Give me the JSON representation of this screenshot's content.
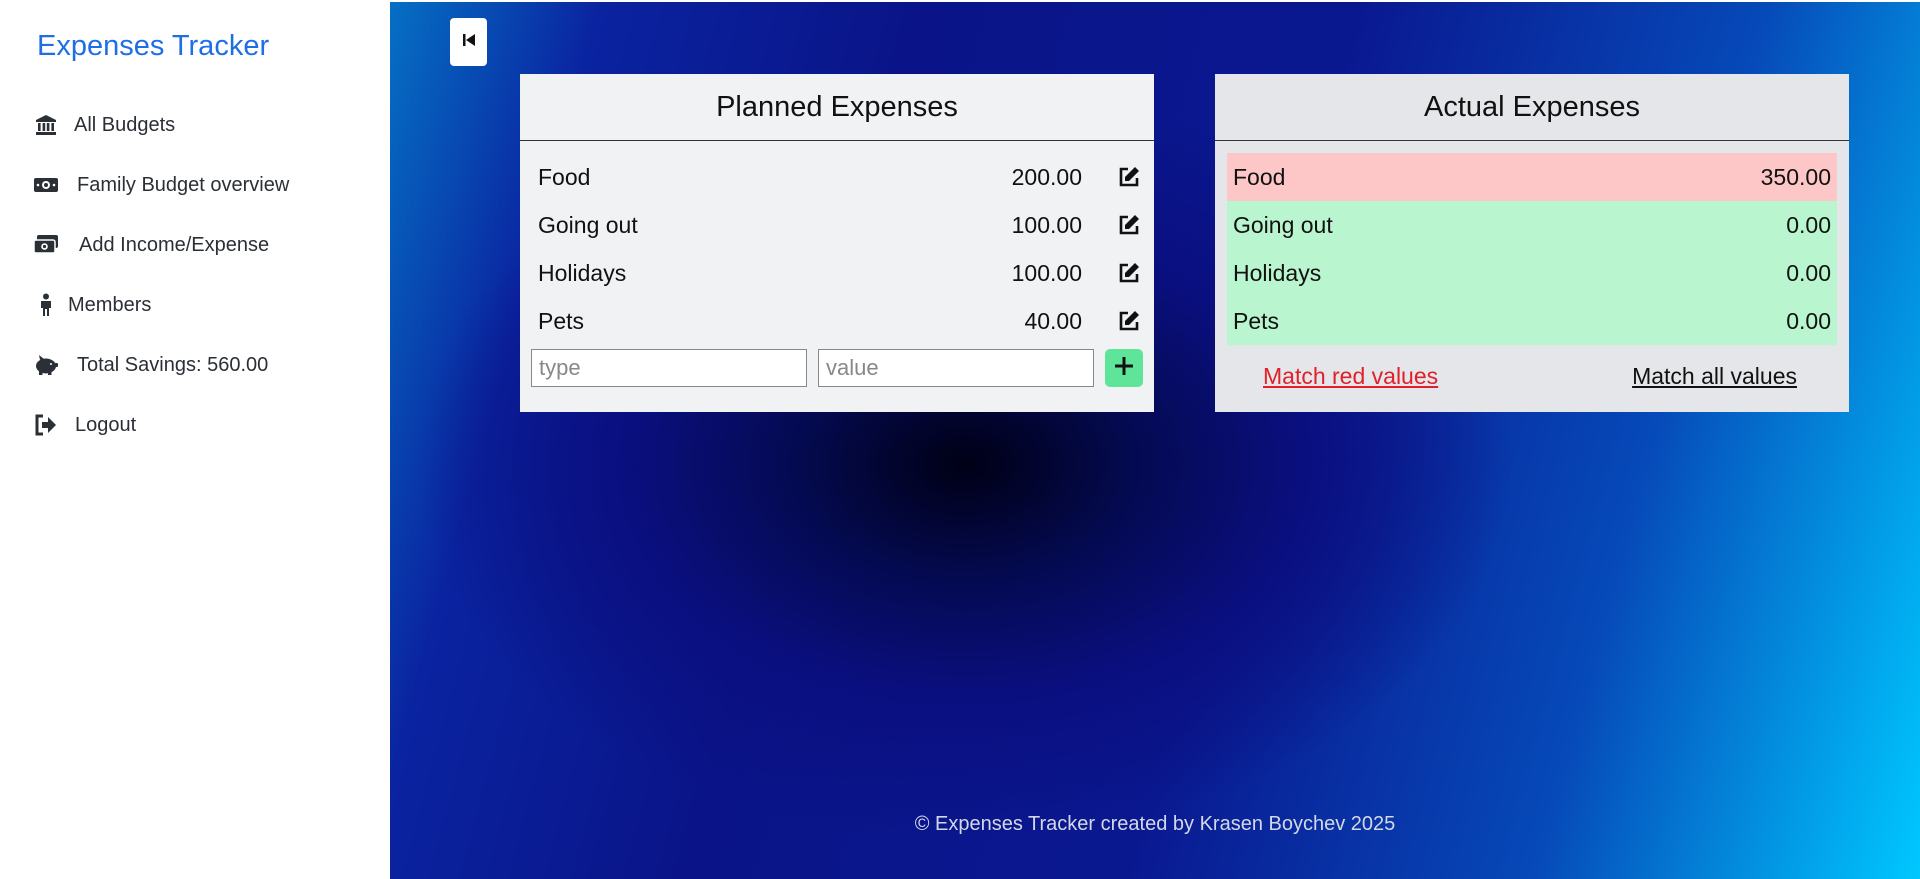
{
  "app": {
    "title": "Expenses Tracker"
  },
  "sidebar": {
    "items": [
      {
        "label": "All Budgets",
        "icon": "bank-icon"
      },
      {
        "label": "Family Budget overview",
        "icon": "money-bill-icon"
      },
      {
        "label": "Add Income/Expense",
        "icon": "money-bills-icon"
      },
      {
        "label": "Members",
        "icon": "person-icon"
      },
      {
        "label": "Total Savings: 560.00",
        "icon": "piggy-bank-icon"
      },
      {
        "label": "Logout",
        "icon": "logout-icon"
      }
    ]
  },
  "planned": {
    "title": "Planned Expenses",
    "rows": [
      {
        "name": "Food",
        "value": "200.00"
      },
      {
        "name": "Going out",
        "value": "100.00"
      },
      {
        "name": "Holidays",
        "value": "100.00"
      },
      {
        "name": "Pets",
        "value": "40.00"
      }
    ],
    "type_placeholder": "type",
    "value_placeholder": "value"
  },
  "actual": {
    "title": "Actual Expenses",
    "rows": [
      {
        "name": "Food",
        "value": "350.00",
        "status": "over"
      },
      {
        "name": "Going out",
        "value": "0.00",
        "status": "ok"
      },
      {
        "name": "Holidays",
        "value": "0.00",
        "status": "ok"
      },
      {
        "name": "Pets",
        "value": "0.00",
        "status": "ok"
      }
    ],
    "match_red_label": "Match red values",
    "match_all_label": "Match all values"
  },
  "colors": {
    "brand": "#1f6ee6",
    "over_budget_row": "#fdc7c7",
    "ok_row": "#b9f5cf",
    "add_button": "#5ee59a",
    "match_red_link": "#e0202a"
  },
  "footer": {
    "text": "© Expenses Tracker created by Krasen Boychev 2025"
  }
}
